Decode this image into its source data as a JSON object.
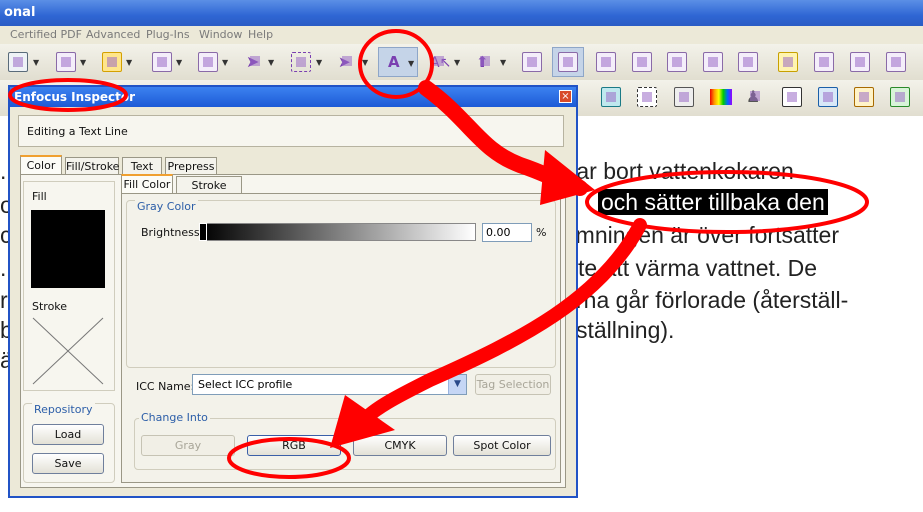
{
  "app": {
    "title_fragment": "onal",
    "menu": [
      "Certified PDF",
      "Advanced",
      "Plug-Ins",
      "Window",
      "Help"
    ]
  },
  "toolbar_icons": [
    "pen-tool-icon",
    "form-field-icon",
    "comment-cloud-icon",
    "page-icon",
    "page-copy-icon",
    "select-arrow-icon",
    "rectangle-select-icon",
    "object-move-icon",
    "text-edit-icon",
    "move-text-icon",
    "pin-icon",
    "checklist-icon",
    "zoom-icon",
    "stamp-icon",
    "checkbox-icon",
    "image-icon",
    "export-icon",
    "page-num-icon",
    "note-icon",
    "add-page-icon",
    "crop-icon",
    "delete-page-icon",
    "insert-page-icon"
  ],
  "toolbar_active": "A",
  "toolbar2_icons": [
    "duplicate-icon",
    "frame-icon",
    "print-check-icon",
    "color-bars-icon",
    "ink-drop-icon",
    "registration-icon",
    "layers-icon",
    "edit-pencil-icon",
    "download-icon"
  ],
  "document": {
    "lines": [
      "tar bort vattenkokaren",
      "och sätter tillbaka den",
      "rmningen är över fortsätter",
      "te att värma vattnet. De",
      "rna går förlorade (återställ-",
      "ställning)."
    ],
    "left_chars": [
      ".",
      "o",
      "c",
      ".",
      "re",
      "b",
      "ä"
    ]
  },
  "inspector": {
    "title": "Enfocus Inspector",
    "close": "×",
    "editing_label": "Editing a Text Line",
    "tabs": [
      "Color",
      "Fill/Stroke",
      "Text",
      "Prepress"
    ],
    "fill_label": "Fill",
    "stroke_label": "Stroke",
    "repository": {
      "title": "Repository",
      "load": "Load",
      "save": "Save"
    },
    "subtabs": [
      "Fill Color",
      "Stroke Color"
    ],
    "gray_color": {
      "title": "Gray Color",
      "brightness_label": "Brightness",
      "brightness_value": "0.00",
      "unit": "%"
    },
    "icc": {
      "label": "ICC Name:",
      "value": "Select ICC profile",
      "tag_selection": "Tag Selection"
    },
    "change_into": {
      "title": "Change Into",
      "buttons": [
        "Gray",
        "RGB",
        "CMYK",
        "Spot Color"
      ]
    }
  },
  "annotation_color": "#ff0000"
}
